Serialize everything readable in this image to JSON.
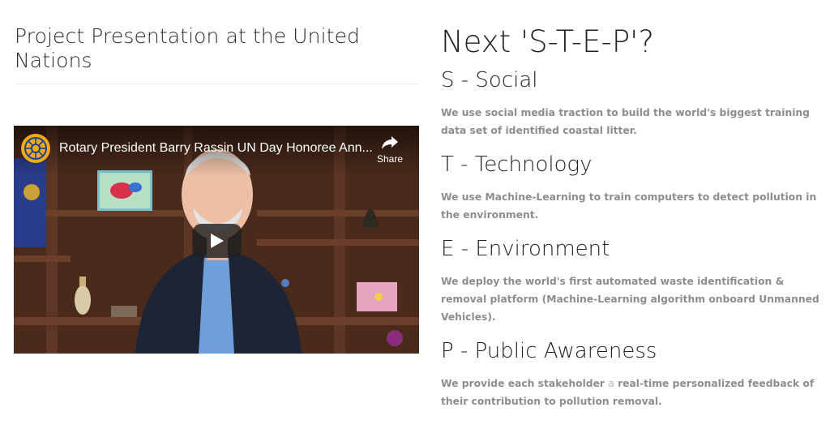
{
  "left": {
    "title": "Project Presentation at the United Nations"
  },
  "video": {
    "title": "Rotary President Barry Rassin UN Day Honoree Ann...",
    "share_label": "Share",
    "channel_icon": "rotary-wheel-icon",
    "play_icon": "play-icon",
    "share_icon": "share-arrow-icon",
    "colors": {
      "logo": "#f7a81b",
      "shelf": "#5a3322"
    }
  },
  "right": {
    "heading": "Next 'S-T-E-P'?",
    "steps": [
      {
        "title": "S - Social",
        "desc": "We use social media traction to build the world's biggest training data set of identified coastal litter."
      },
      {
        "title": "T - Technology",
        "desc": "We use Machine-Learning to train computers to detect pollution in the environment."
      },
      {
        "title": "E - Environment",
        "desc": "We deploy the world's first automated waste identification & removal platform (Machine-Learning algorithm onboard Unmanned Vehicles)."
      },
      {
        "title": "P - Public Awareness",
        "desc_pre": "We provide each stakeholder",
        "desc_light": "a",
        "desc_post": "real-time personalized feedback of their contribution to pollution removal."
      }
    ]
  }
}
